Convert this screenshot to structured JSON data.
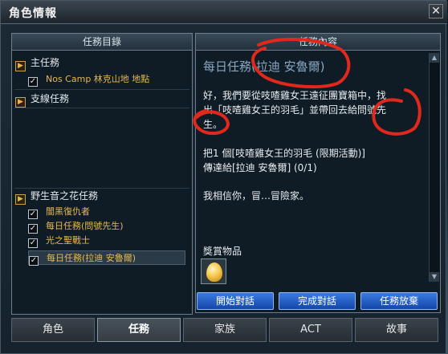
{
  "window": {
    "title": "角色情報",
    "close_glyph": "✕"
  },
  "left_panel": {
    "header": "任務目錄",
    "main_category": "主任務",
    "main_items": [
      "Nos Camp 林克山地 地點"
    ],
    "side_category": "支線任務",
    "event_category": "野生音之花任務",
    "event_items": [
      "闇黑復仇者",
      "每日任務(問號先生)",
      "光之聖戰士",
      "每日任務(拉迪 安魯爾)"
    ]
  },
  "right_panel": {
    "header": "任務內容",
    "quest_title": "每日任務(拉迪 安魯爾)",
    "desc_line1": "好，我們要從吱喳雞女王遠征團寶箱中，找",
    "desc_line2": "出「吱喳雞女王的羽毛」並帶回去給問號先",
    "desc_line3": "生。",
    "objective1": "把1 個[吱喳雞女王的羽毛 (限期活動)]",
    "objective2": "傳達給[拉迪 安魯爾]  (0/1)",
    "closing": "我相信你，冒…冒險家。",
    "reward_label": "獎賞物品",
    "reward_icon": "golden-egg-icon",
    "buttons": {
      "start": "開始對話",
      "complete": "完成對話",
      "abandon": "任務放棄"
    }
  },
  "tabs": [
    "角色",
    "任務",
    "家族",
    "ACT",
    "故事"
  ],
  "active_tab": "任務",
  "colors": {
    "quest_item": "#e6b84d",
    "button_blue": "#2a63c8",
    "marker_red": "#e0281c"
  }
}
